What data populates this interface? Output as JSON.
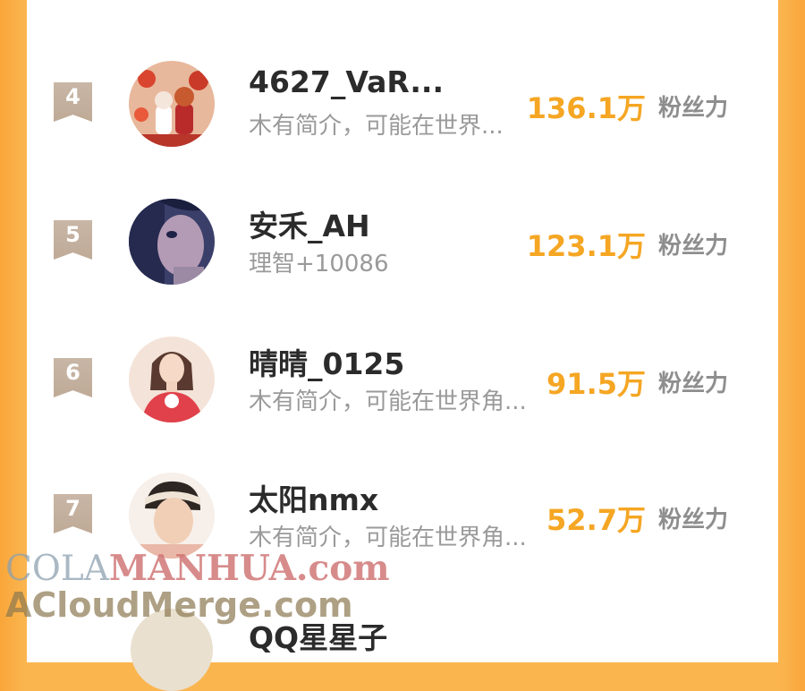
{
  "ranking": [
    {
      "rank": "4",
      "name": "4627_VaR...",
      "bio": "木有简介，可能在世界...",
      "fans": "136.1万",
      "fans_label": "粉丝力"
    },
    {
      "rank": "5",
      "name": "安禾_AH",
      "bio": "理智+10086",
      "fans": "123.1万",
      "fans_label": "粉丝力"
    },
    {
      "rank": "6",
      "name": "晴晴_0125",
      "bio": "木有简介，可能在世界角...",
      "fans": "91.5万",
      "fans_label": "粉丝力"
    },
    {
      "rank": "7",
      "name": "太阳nmx",
      "bio": "木有简介，可能在世界角...",
      "fans": "52.7万",
      "fans_label": "粉丝力"
    }
  ],
  "partial_next": {
    "name": "QQ星星子"
  },
  "watermark": {
    "line1_a": "COLA",
    "line1_b": "MANHUA.com",
    "line2": "ACloudMerge.com"
  },
  "colors": {
    "accent": "#f5a623",
    "background": "#fbb54e",
    "rank_badge": "#c8b6a6",
    "name": "#2b2b2b",
    "bio": "#9a9a9a"
  }
}
